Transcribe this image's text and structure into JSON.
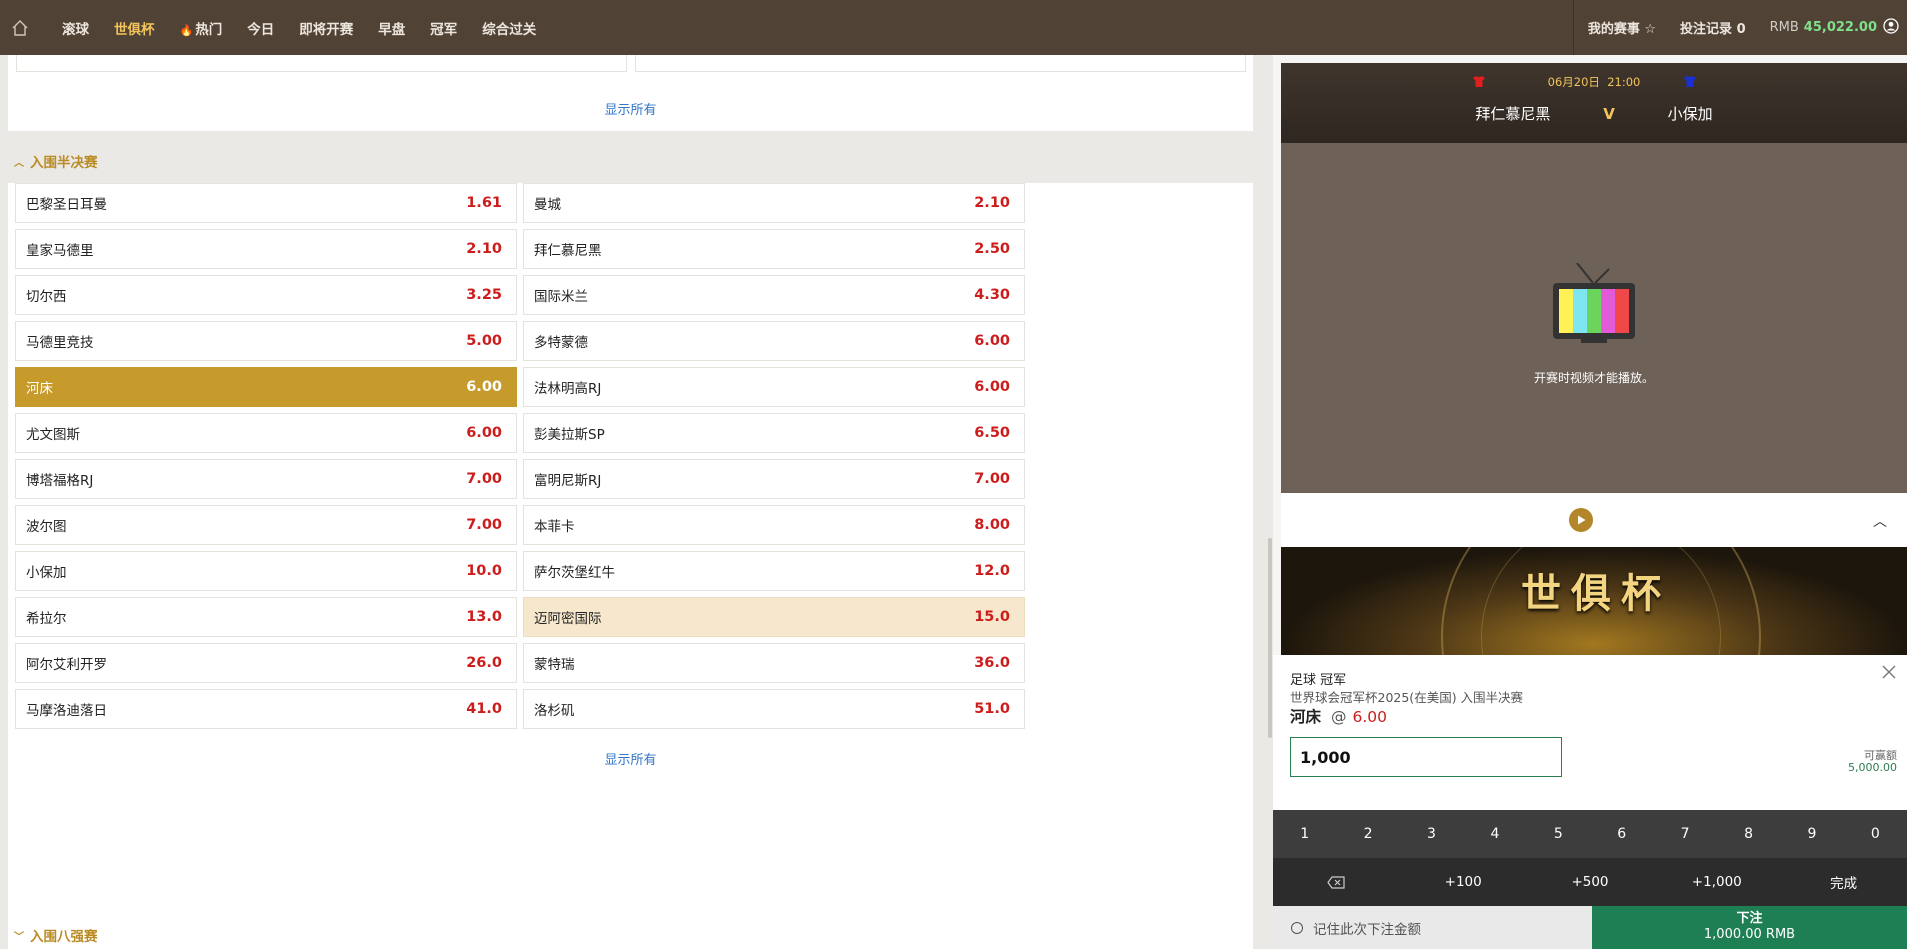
{
  "topbar": {
    "nav": [
      {
        "label": "滚球",
        "active": false
      },
      {
        "label": "世俱杯",
        "active": true
      },
      {
        "label": "热门",
        "active": false,
        "icon": "fire-icon"
      },
      {
        "label": "今日",
        "active": false
      },
      {
        "label": "即将开赛",
        "active": false
      },
      {
        "label": "早盘",
        "active": false
      },
      {
        "label": "冠军",
        "active": false
      },
      {
        "label": "综合过关",
        "active": false
      }
    ],
    "my_events": "我的赛事",
    "bet_records": "投注记录 0",
    "currency": "RMB",
    "balance": "45,022.00"
  },
  "market": {
    "top_show_all": "显示所有",
    "semifinal": {
      "title": "入围半决赛",
      "rows": [
        [
          {
            "name": "巴黎圣日耳曼",
            "odds": "1.61"
          },
          {
            "name": "曼城",
            "odds": "2.10"
          }
        ],
        [
          {
            "name": "皇家马德里",
            "odds": "2.10"
          },
          {
            "name": "拜仁慕尼黑",
            "odds": "2.50"
          }
        ],
        [
          {
            "name": "切尔西",
            "odds": "3.25"
          },
          {
            "name": "国际米兰",
            "odds": "4.30"
          }
        ],
        [
          {
            "name": "马德里竞技",
            "odds": "5.00"
          },
          {
            "name": "多特蒙德",
            "odds": "6.00"
          }
        ],
        [
          {
            "name": "河床",
            "odds": "6.00",
            "state": "selected"
          },
          {
            "name": "法林明高RJ",
            "odds": "6.00"
          }
        ],
        [
          {
            "name": "尤文图斯",
            "odds": "6.00"
          },
          {
            "name": "彭美拉斯SP",
            "odds": "6.50"
          }
        ],
        [
          {
            "name": "博塔福格RJ",
            "odds": "7.00"
          },
          {
            "name": "富明尼斯RJ",
            "odds": "7.00"
          }
        ],
        [
          {
            "name": "波尔图",
            "odds": "7.00"
          },
          {
            "name": "本菲卡",
            "odds": "8.00"
          }
        ],
        [
          {
            "name": "小保加",
            "odds": "10.0"
          },
          {
            "name": "萨尔茨堡红牛",
            "odds": "12.0"
          }
        ],
        [
          {
            "name": "希拉尔",
            "odds": "13.0"
          },
          {
            "name": "迈阿密国际",
            "odds": "15.0",
            "state": "highlight"
          }
        ],
        [
          {
            "name": "阿尔艾利开罗",
            "odds": "26.0"
          },
          {
            "name": "蒙特瑞",
            "odds": "36.0"
          }
        ],
        [
          {
            "name": "马摩洛迪落日",
            "odds": "41.0"
          },
          {
            "name": "洛杉矶",
            "odds": "51.0"
          }
        ]
      ],
      "show_all": "显示所有"
    },
    "quarterfinal": {
      "title": "入围八强赛"
    }
  },
  "video": {
    "date": "06月20日",
    "time": "21:00",
    "home_team": "拜仁慕尼黑",
    "vs": "V",
    "away_team": "小保加",
    "home_shirt_color": "#e02020",
    "away_shirt_color": "#1a2fd6",
    "message": "开赛时视频才能播放。",
    "banner_text": "世俱杯"
  },
  "betslip": {
    "sport_market": "足球 冠军",
    "competition": "世界球会冠军杯2025(在美国) 入围半决赛",
    "selection": "河床",
    "at": "@",
    "odds": "6.00",
    "stake": "1,000",
    "max_label": "可赢额",
    "max_value": "5,000.00",
    "keypad": [
      "1",
      "2",
      "3",
      "4",
      "5",
      "6",
      "7",
      "8",
      "9",
      "0"
    ],
    "quick": [
      "+100",
      "+500",
      "+1,000"
    ],
    "done": "完成",
    "remember": "记住此次下注金额",
    "place_label": "下注",
    "place_amount": "1,000.00 RMB"
  }
}
